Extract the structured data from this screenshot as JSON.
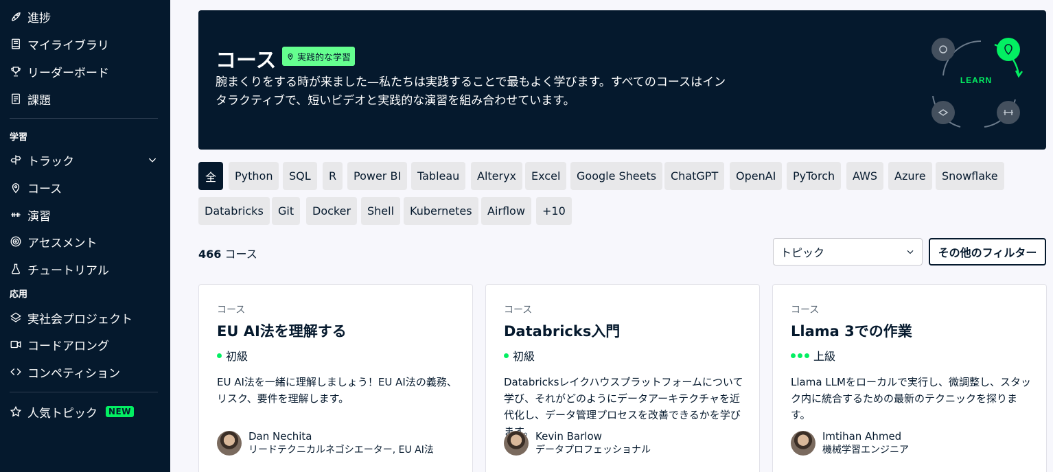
{
  "sidebar": {
    "items_top": [
      {
        "label": "進捗",
        "icon": "rocket-icon"
      },
      {
        "label": "マイライブラリ",
        "icon": "book-icon"
      },
      {
        "label": "リーダーボード",
        "icon": "trophy-icon"
      },
      {
        "label": "課題",
        "icon": "assignment-icon"
      }
    ],
    "section_learn": "学習",
    "items_learn": [
      {
        "label": "トラック",
        "icon": "track-icon"
      },
      {
        "label": "コース",
        "icon": "course-icon"
      },
      {
        "label": "演習",
        "icon": "dumbbell-icon"
      },
      {
        "label": "アセスメント",
        "icon": "target-icon"
      },
      {
        "label": "チュートリアル",
        "icon": "flask-icon"
      }
    ],
    "section_apply": "応用",
    "items_apply": [
      {
        "label": "実社会プロジェクト",
        "icon": "layers-icon"
      },
      {
        "label": "コードアロング",
        "icon": "video-icon"
      },
      {
        "label": "コンペティション",
        "icon": "code-icon"
      }
    ],
    "popular": {
      "label": "人気トピック",
      "badge": "NEW",
      "icon": "star-icon"
    }
  },
  "hero": {
    "title": "コース",
    "badge": "実践的な学習",
    "description": "腕まくりをする時が来ました—私たちは実践することで最もよく学びます。すべてのコースはインタラクティブで、短いビデオと実践的な演習を組み合わせています。",
    "graphic_label": "LEARN"
  },
  "filters": [
    "全",
    "Python",
    "SQL",
    "R",
    "Power BI",
    "Tableau",
    "Alteryx",
    "Excel",
    "Google Sheets",
    "ChatGPT",
    "OpenAI",
    "PyTorch",
    "AWS",
    "Azure",
    "Snowflake",
    "Databricks",
    "Git",
    "Docker",
    "Shell",
    "Kubernetes",
    "Airflow",
    "+10"
  ],
  "results": {
    "count": "466",
    "unit": "コース"
  },
  "topic_select": {
    "value": "トピック"
  },
  "more_filters_label": "その他のフィルター",
  "cards": [
    {
      "type": "コース",
      "title": "EU AI法を理解する",
      "level": "初級",
      "level_dots": 1,
      "description": "EU AI法を一緒に理解しましょう！EU AI法の義務、リスク、要件を理解します。",
      "author_name": "Dan Nechita",
      "author_role": "リードテクニカルネゴシエーター, EU AI法"
    },
    {
      "type": "コース",
      "title": "Databricks入門",
      "level": "初級",
      "level_dots": 1,
      "description": "Databricksレイクハウスプラットフォームについて学び、それがどのようにデータアーキテクチャを近代化し、データ管理プロセスを改善できるかを学びます。",
      "author_name": "Kevin Barlow",
      "author_role": "データプロフェッショナル"
    },
    {
      "type": "コース",
      "title": "Llama 3での作業",
      "level": "上級",
      "level_dots": 3,
      "description": "Llama LLMをローカルで実行し、微調整し、スタック内に統合するための最新のテクニックを探ります。",
      "author_name": "Imtihan Ahmed",
      "author_role": "機械学習エンジニア"
    }
  ],
  "colors": {
    "navy": "#05192d",
    "green": "#03ef62",
    "light_green": "#65ff8f",
    "background": "#f7f7fc"
  }
}
